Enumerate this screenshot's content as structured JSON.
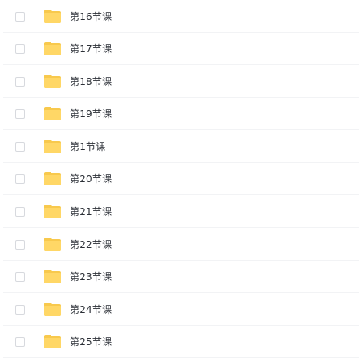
{
  "file_list": {
    "rows": [
      {
        "name": "第16节课",
        "icon": "folder-icon",
        "checked": false
      },
      {
        "name": "第17节课",
        "icon": "folder-icon",
        "checked": false
      },
      {
        "name": "第18节课",
        "icon": "folder-icon",
        "checked": false
      },
      {
        "name": "第19节课",
        "icon": "folder-icon",
        "checked": false
      },
      {
        "name": "第1节课",
        "icon": "folder-icon",
        "checked": false
      },
      {
        "name": "第20节课",
        "icon": "folder-icon",
        "checked": false
      },
      {
        "name": "第21节课",
        "icon": "folder-icon",
        "checked": false
      },
      {
        "name": "第22节课",
        "icon": "folder-icon",
        "checked": false
      },
      {
        "name": "第23节课",
        "icon": "folder-icon",
        "checked": false
      },
      {
        "name": "第24节课",
        "icon": "folder-icon",
        "checked": false
      },
      {
        "name": "第25节课",
        "icon": "folder-icon",
        "checked": false
      }
    ],
    "colors": {
      "folder_back": "#f8c94d",
      "folder_front": "#ffd766",
      "text": "#2b2f36",
      "divider": "#f2f3f5",
      "checkbox_border": "#d7d9de"
    }
  }
}
